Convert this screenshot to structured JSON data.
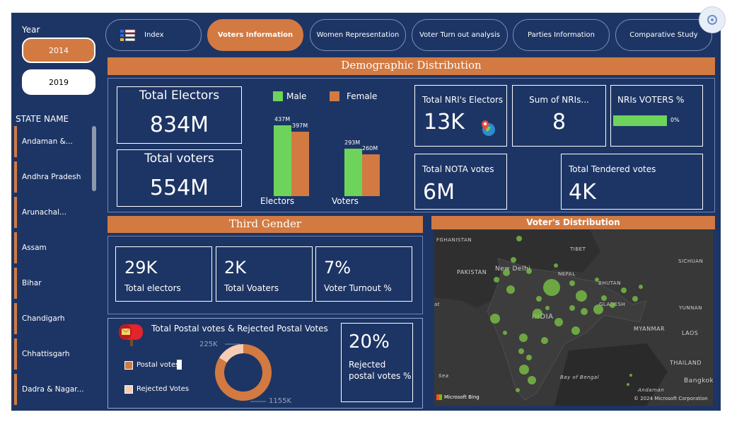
{
  "left_panel": {
    "year_label": "Year",
    "years": [
      "2014",
      "2019"
    ],
    "state_title": "STATE NAME",
    "states": [
      "Andaman &...",
      "Andhra Pradesh",
      "Arunachal...",
      "Assam",
      "Bihar",
      "Chandigarh",
      "Chhattisgarh",
      "Dadra & Nagar..."
    ]
  },
  "nav": {
    "index": "Index",
    "voters_info": "Voters Information",
    "women": "Women Representation",
    "turnout": "Voter Turn out analysis",
    "parties": "Parties Information",
    "comparative": "Comparative Study"
  },
  "demographic": {
    "banner": "Demographic Distribution",
    "total_electors_label": "Total Electors",
    "total_electors_value": "834M",
    "total_voters_label": "Total voters",
    "total_voters_value": "554M",
    "legend_male": "Male",
    "legend_female": "Female",
    "electors_label": "Electors",
    "voters_label": "Voters",
    "electors_male": "437M",
    "electors_female": "397M",
    "voters_male": "293M",
    "voters_female": "260M",
    "nri_electors_label": "Total NRI's Electors",
    "nri_electors_value": "13K",
    "sum_nri_label": "Sum of NRIs...",
    "sum_nri_value": "8",
    "nri_voters_pct_label": "NRIs VOTERS %",
    "nri_voters_pct_value": "0%",
    "nota_label": "Total NOTA votes",
    "nota_value": "6M",
    "tendered_label": "Total Tendered votes",
    "tendered_value": "4K"
  },
  "chart_data": {
    "type": "bar",
    "categories": [
      "Electors",
      "Voters"
    ],
    "series": [
      {
        "name": "Male",
        "values": [
          437,
          293
        ]
      },
      {
        "name": "Female",
        "values": [
          397,
          260
        ]
      }
    ],
    "colors": {
      "Male": "#6ed35b",
      "Female": "#d27a42"
    }
  },
  "third_gender": {
    "banner": "Third Gender",
    "electors_value": "29K",
    "electors_label": "Total electors",
    "voaters_value": "2K",
    "voaters_label": "Total Voaters",
    "turnout_value": "7%",
    "turnout_label": "Voter Turnout %"
  },
  "postal": {
    "title": "Total Postal votes & Rejected Postal Votes",
    "legend_postal": "Postal votes",
    "legend_rejected": "Rejected Votes",
    "value_rejected": "225K",
    "value_postal": "1155K",
    "rejected_pct_value": "20%",
    "rejected_pct_label_1": "Rejected",
    "rejected_pct_label_2": "postal votes %",
    "donut": {
      "postal": 1155,
      "rejected": 225
    }
  },
  "map": {
    "banner": "Voter's Distribution",
    "labels": [
      "FGHANISTAN",
      "TIBET",
      "PAKISTAN",
      "New Delhi",
      "NEPAL",
      "BHUTAN",
      "SICHUAN",
      "INDIA",
      "GLADESH",
      "YUNNAN",
      "MYANMAR",
      "LAOS",
      "Bay of Bengal",
      "THAILAND",
      "Andaman",
      "Bangkok",
      "Sea",
      "at"
    ],
    "bing": "Microsoft Bing",
    "copyright": "© 2024 Microsoft Corporation"
  },
  "colors": {
    "accent": "#d27a42",
    "panel": "#1d3565",
    "green": "#6ed35b"
  }
}
